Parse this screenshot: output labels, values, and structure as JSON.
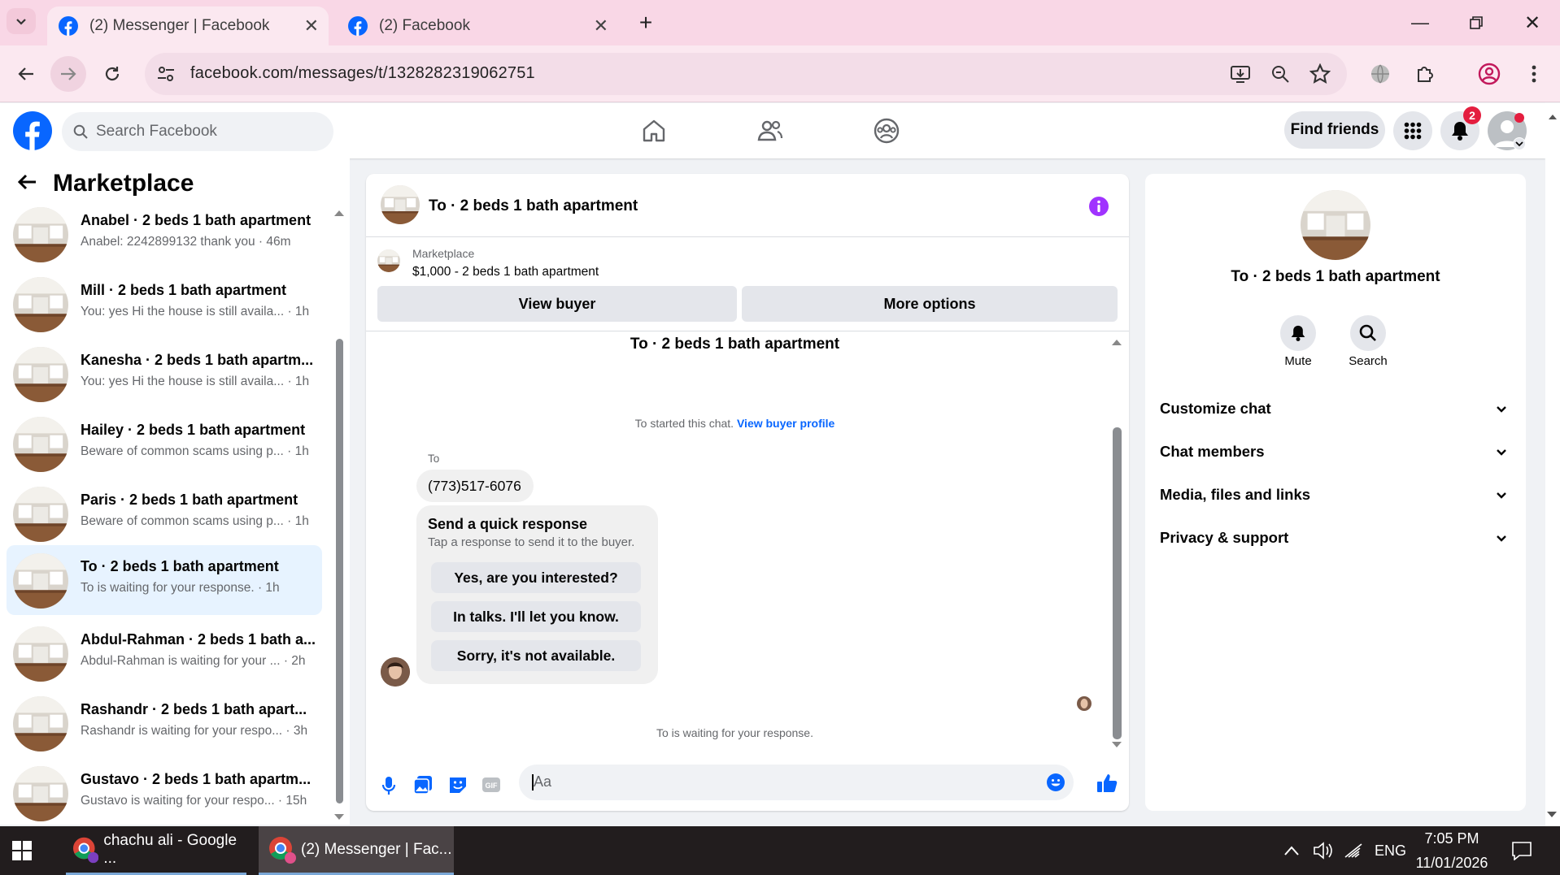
{
  "browser": {
    "tabs": [
      {
        "title": "(2) Messenger | Facebook",
        "active": true
      },
      {
        "title": "(2) Facebook",
        "active": false
      }
    ],
    "url": "facebook.com/messages/t/1328282319062751"
  },
  "fb_header": {
    "search_placeholder": "Search Facebook",
    "find_friends": "Find friends",
    "notification_count": "2"
  },
  "sidebar": {
    "title": "Marketplace",
    "conversations": [
      {
        "name": "Anabel · 2 beds 1 bath apartment",
        "snippet": "Anabel: 2242899132 thank you · 46m"
      },
      {
        "name": "Mill · 2 beds 1 bath apartment",
        "snippet": "You: yes Hi the house is still availa... · 1h"
      },
      {
        "name": "Kanesha · 2 beds 1 bath apartm...",
        "snippet": "You: yes Hi the house is still availa... · 1h"
      },
      {
        "name": "Hailey · 2 beds 1 bath apartment",
        "snippet": "Beware of common scams using p... · 1h"
      },
      {
        "name": "Paris · 2 beds 1 bath apartment",
        "snippet": "Beware of common scams using p... · 1h"
      },
      {
        "name": "To · 2 beds 1 bath apartment",
        "snippet": "To is waiting for your response. · 1h"
      },
      {
        "name": "Abdul-Rahman · 2 beds 1 bath a...",
        "snippet": "Abdul-Rahman is waiting for your ... · 2h"
      },
      {
        "name": "Rashandr · 2 beds 1 bath apart...",
        "snippet": "Rashandr is waiting for your respo... · 3h"
      },
      {
        "name": "Gustavo · 2 beds 1 bath apartm...",
        "snippet": "Gustavo is waiting for your respo... · 15h"
      }
    ]
  },
  "chat": {
    "header_title": "To · 2 beds 1 bath apartment",
    "listing_label": "Marketplace",
    "listing_title": "$1,000 - 2 beds 1 bath apartment",
    "view_buyer": "View buyer",
    "more_options": "More options",
    "thread_title": "To · 2 beds 1 bath apartment",
    "started_text": "To started this chat.",
    "view_buyer_profile": "View buyer profile",
    "sender_name": "To",
    "phone_message": "(773)517-6076",
    "quick_title": "Send a quick response",
    "quick_sub": "Tap a response to send it to the buyer.",
    "quick_replies": [
      "Yes, are you interested?",
      "In talks. I'll let you know.",
      "Sorry, it's not available."
    ],
    "waiting_text": "To is waiting for your response.",
    "composer_placeholder": "Aa"
  },
  "details": {
    "title": "To · 2 beds 1 bath apartment",
    "mute": "Mute",
    "search": "Search",
    "sections": [
      "Customize chat",
      "Chat members",
      "Media, files and links",
      "Privacy & support"
    ]
  },
  "taskbar": {
    "items": [
      "chachu ali - Google ...",
      "(2) Messenger | Fac..."
    ],
    "lang": "ENG",
    "time": "7:05 PM",
    "date": "11/01/2026"
  },
  "colors": {
    "fb_blue": "#0866ff",
    "accent_purple": "#a033ff",
    "selected_row": "#e7f3ff"
  }
}
